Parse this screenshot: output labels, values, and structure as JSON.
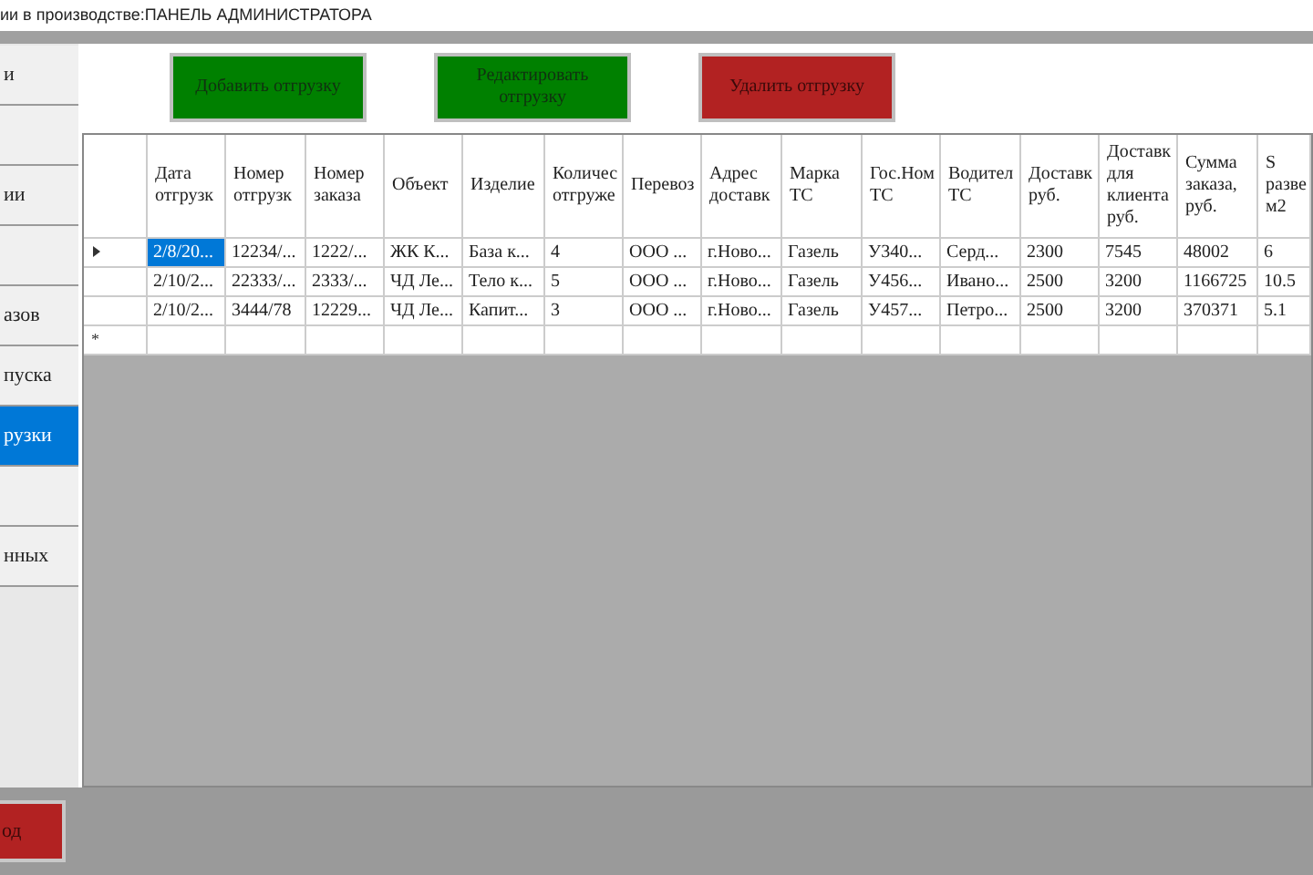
{
  "window": {
    "title": "ии в производстве:ПАНЕЛЬ АДМИНИСТРАТОРА"
  },
  "sidebar": {
    "items": [
      {
        "label": "и",
        "selected": false
      },
      {
        "selected": false
      },
      {
        "label": "ии",
        "selected": false
      },
      {
        "selected": false
      },
      {
        "label": "азов",
        "selected": false
      },
      {
        "label": "пуска",
        "selected": false
      },
      {
        "label": "рузки",
        "selected": true
      },
      {
        "selected": false
      },
      {
        "label": "нных",
        "selected": false
      }
    ],
    "exit_button": "од"
  },
  "toolbar": [
    {
      "label": "Добавить отгрузку",
      "kind": "ok"
    },
    {
      "label": "Редактировать отгрузку",
      "kind": "ok"
    },
    {
      "label": "Удалить отгрузку",
      "kind": "danger"
    }
  ],
  "table": {
    "columns": [
      "Дата отгрузк",
      "Номер отгрузк",
      "Номер заказа",
      "Объект",
      "Изделие",
      "Количес отгруже",
      "Перевоз",
      "Адрес доставк",
      "Марка ТС",
      "Гос.Ном ТС",
      "Водител ТС",
      "Доставк руб.",
      "Доставк для клиента руб.",
      "Сумма заказа, руб.",
      "S разве м2"
    ],
    "rows": [
      {
        "selected": true,
        "cells": [
          "2/8/20...",
          "12234/...",
          "1222/...",
          "ЖК К...",
          "База к...",
          "4",
          "ООО ...",
          "г.Ново...",
          "Газель",
          "У340...",
          "Серд...",
          "2300",
          "7545",
          "48002",
          "6"
        ]
      },
      {
        "selected": false,
        "cells": [
          "2/10/2...",
          "22333/...",
          "2333/...",
          "ЧД Ле...",
          "Тело к...",
          "5",
          "ООО ...",
          "г.Ново...",
          "Газель",
          "У456...",
          "Ивано...",
          "2500",
          "3200",
          "1166725",
          "10.5"
        ]
      },
      {
        "selected": false,
        "cells": [
          "2/10/2...",
          "3444/78",
          "12229...",
          "ЧД Ле...",
          "Капит...",
          "3",
          "ООО ...",
          "г.Ново...",
          "Газель",
          "У457...",
          "Петро...",
          "2500",
          "3200",
          "370371",
          "5.1"
        ]
      }
    ],
    "new_row_marker": "*"
  }
}
